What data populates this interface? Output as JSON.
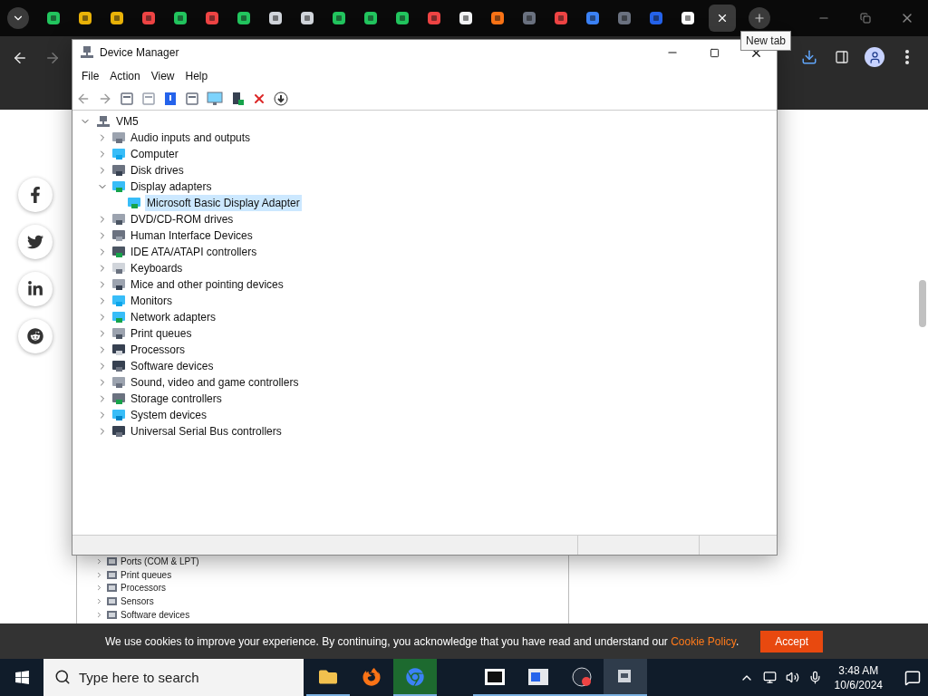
{
  "browser": {
    "tooltip": "New tab"
  },
  "page": {
    "background_tree": [
      "Ports (COM & LPT)",
      "Print queues",
      "Processors",
      "Sensors",
      "Software devices"
    ]
  },
  "device_manager": {
    "title": "Device Manager",
    "menu": [
      "File",
      "Action",
      "View",
      "Help"
    ],
    "tree": {
      "label": "VM5",
      "expanded": true,
      "children": [
        {
          "label": "Audio inputs and outputs",
          "expanded": false
        },
        {
          "label": "Computer",
          "expanded": false
        },
        {
          "label": "Disk drives",
          "expanded": false
        },
        {
          "label": "Display adapters",
          "expanded": true,
          "children": [
            {
              "label": "Microsoft Basic Display Adapter",
              "selected": true
            }
          ]
        },
        {
          "label": "DVD/CD-ROM drives",
          "expanded": false
        },
        {
          "label": "Human Interface Devices",
          "expanded": false
        },
        {
          "label": "IDE ATA/ATAPI controllers",
          "expanded": false
        },
        {
          "label": "Keyboards",
          "expanded": false
        },
        {
          "label": "Mice and other pointing devices",
          "expanded": false
        },
        {
          "label": "Monitors",
          "expanded": false
        },
        {
          "label": "Network adapters",
          "expanded": false
        },
        {
          "label": "Print queues",
          "expanded": false
        },
        {
          "label": "Processors",
          "expanded": false
        },
        {
          "label": "Software devices",
          "expanded": false
        },
        {
          "label": "Sound, video and game controllers",
          "expanded": false
        },
        {
          "label": "Storage controllers",
          "expanded": false
        },
        {
          "label": "System devices",
          "expanded": false
        },
        {
          "label": "Universal Serial Bus controllers",
          "expanded": false
        }
      ]
    }
  },
  "cookie_banner": {
    "text": "We use cookies to improve your experience. By continuing, you acknowledge that you have read and understand our",
    "link": "Cookie Policy",
    "after_link": ".",
    "button": "Accept"
  },
  "taskbar": {
    "search_placeholder": "Type here to search",
    "time": "3:48 AM",
    "date": "10/6/2024",
    "apps": [
      {
        "running": true,
        "active": false
      },
      {
        "running": false,
        "active": false
      },
      {
        "running": true,
        "active": false
      },
      {
        "running": true,
        "active": false
      },
      {
        "running": true,
        "active": false
      },
      {
        "running": true,
        "active": false
      },
      {
        "running": true,
        "active": true
      }
    ]
  }
}
